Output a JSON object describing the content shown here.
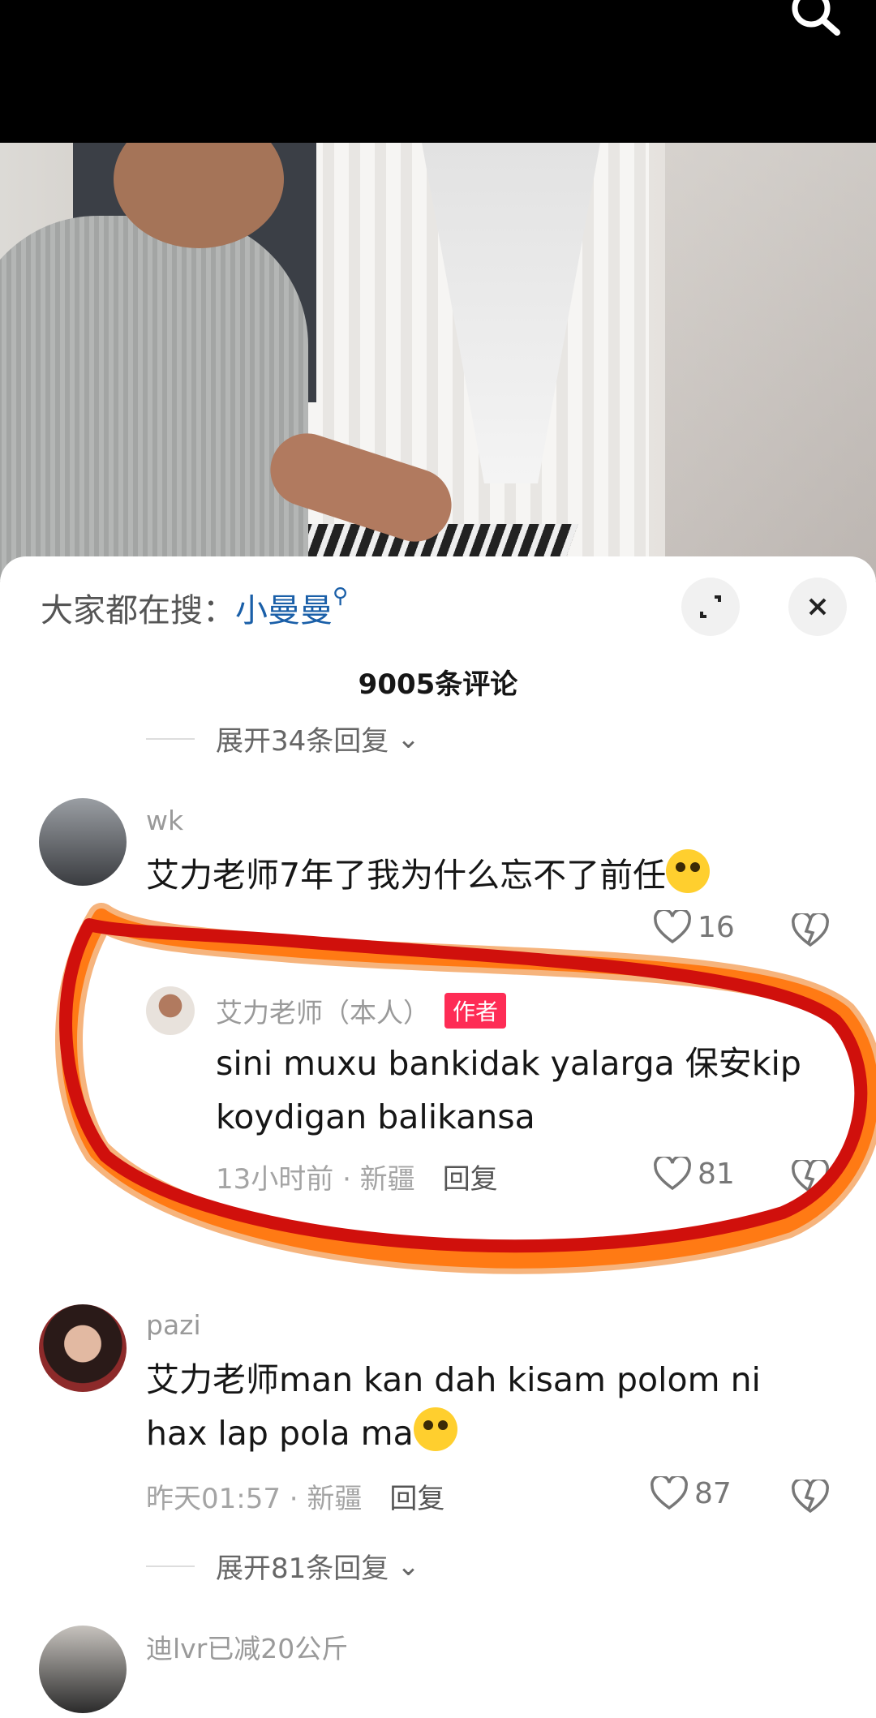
{
  "header": {
    "search_icon": "search-icon"
  },
  "panel": {
    "hot_label": "大家都在搜：",
    "hot_term": "小曼曼",
    "comment_count": "9005条评论"
  },
  "comments": [
    {
      "expand_above": "展开34条回复",
      "user": "wk",
      "text": "艾力老师7年了我为什么忘不了前任",
      "likes": "16"
    },
    {
      "user": "艾力老师（本人）",
      "badge": "作者",
      "text_line1": "sini muxu  bankidak  yalarga 保安kip",
      "text_line2": "koydigan balikansa",
      "time": "13小时前 · 新疆",
      "reply": "回复",
      "likes": "81"
    },
    {
      "user": "pazi",
      "text_line1": "艾力老师man kan dah kisam polom ni",
      "text_line2": "hax lap  pola ma",
      "time": "昨天01:57 · 新疆",
      "reply": "回复",
      "likes": "87",
      "expand": "展开81条回复"
    },
    {
      "user": "迪lvr已减20公斤"
    }
  ],
  "colors": {
    "accent_link": "#1a5fa8",
    "badge": "#fe2c55",
    "annotation_red": "#d0100c",
    "annotation_orange": "#ff7a14"
  }
}
